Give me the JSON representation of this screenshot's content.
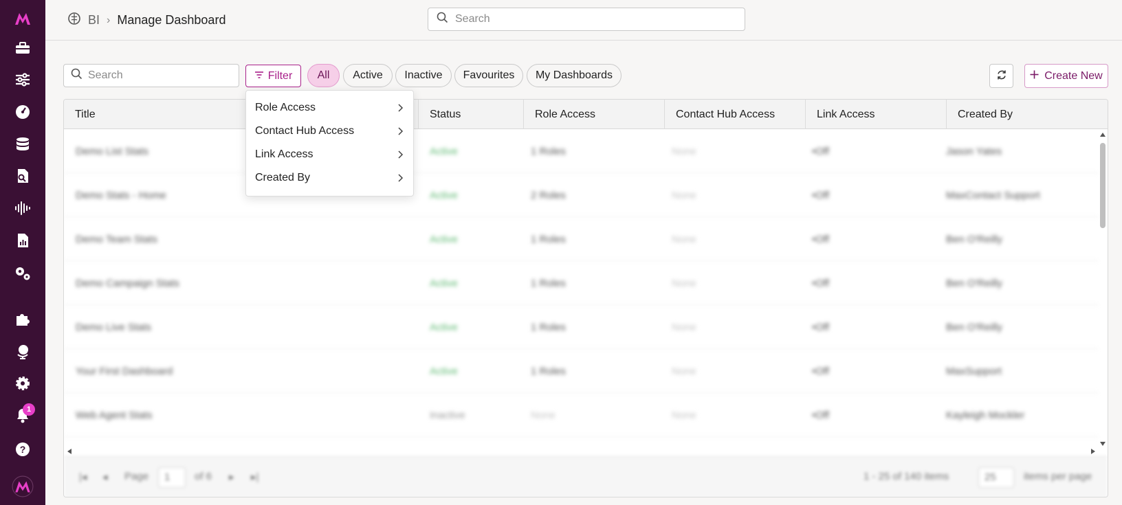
{
  "colors": {
    "sidebar_bg": "#3a1034",
    "accent": "#a8208a",
    "chip_active": "#f6cfe8",
    "status_active": "#5cb870"
  },
  "sidebar": {
    "icons": [
      "logo-icon",
      "toolbox-icon",
      "sliders-icon",
      "dashboard-gauge-icon",
      "database-icon",
      "file-search-icon",
      "audio-wave-icon",
      "report-chart-icon",
      "cogs-icon",
      "puzzle-icon",
      "globe-icon",
      "settings-icon",
      "bell-icon",
      "help-icon",
      "avatar-logo-icon"
    ],
    "notification_count": "1"
  },
  "header": {
    "breadcrumb_root": "BI",
    "breadcrumb_sep": "›",
    "page_title": "Manage Dashboard",
    "search_placeholder": "Search"
  },
  "toolbar": {
    "search_placeholder": "Search",
    "filter_label": "Filter",
    "chips": [
      "All",
      "Active",
      "Inactive",
      "Favourites",
      "My Dashboards"
    ],
    "active_chip": "All",
    "create_label": "Create New"
  },
  "filter_menu": {
    "items": [
      "Role Access",
      "Contact Hub Access",
      "Link Access",
      "Created By"
    ]
  },
  "table": {
    "columns": [
      "Title",
      "Status",
      "Role Access",
      "Contact Hub Access",
      "Link Access",
      "Created By"
    ],
    "rows": [
      {
        "title": "Demo List Stats",
        "status": "Active",
        "role_access": "1 Roles",
        "contact_hub": "None",
        "link_access": "Off",
        "created_by": "Jason Yates"
      },
      {
        "title": "Demo Stats - Home",
        "status": "Active",
        "role_access": "2 Roles",
        "contact_hub": "None",
        "link_access": "Off",
        "created_by": "MaxContact Support"
      },
      {
        "title": "Demo Team Stats",
        "status": "Active",
        "role_access": "1 Roles",
        "contact_hub": "None",
        "link_access": "Off",
        "created_by": "Ben O'Reilly"
      },
      {
        "title": "Demo Campaign Stats",
        "status": "Active",
        "role_access": "1 Roles",
        "contact_hub": "None",
        "link_access": "Off",
        "created_by": "Ben O'Reilly"
      },
      {
        "title": "Demo Live Stats",
        "status": "Active",
        "role_access": "1 Roles",
        "contact_hub": "None",
        "link_access": "Off",
        "created_by": "Ben O'Reilly"
      },
      {
        "title": "Your First Dashboard",
        "status": "Active",
        "role_access": "1 Roles",
        "contact_hub": "None",
        "link_access": "Off",
        "created_by": "MaxSupport"
      },
      {
        "title": "Web Agent Stats",
        "status": "Inactive",
        "role_access": "None",
        "contact_hub": "None",
        "link_access": "Off",
        "created_by": "Kayleigh Mockler"
      }
    ]
  },
  "pager": {
    "page_label": "Page",
    "page_value": "1",
    "of_label": "of 6",
    "range_label": "1 - 25 of 140 items",
    "page_size": "25",
    "per_page_label": "items per page"
  }
}
